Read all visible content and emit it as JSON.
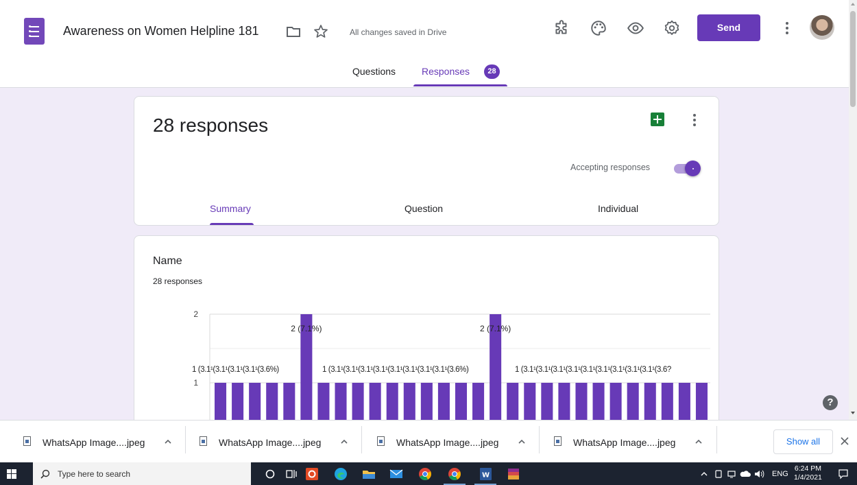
{
  "header": {
    "doc_title": "Awareness on Women Helpline 181",
    "save_status": "All changes saved in Drive",
    "send_label": "Send",
    "tabs": [
      {
        "label": "Questions"
      },
      {
        "label": "Responses",
        "badge": "28"
      }
    ]
  },
  "summary_card": {
    "response_count": "28 responses",
    "accepting_label": "Accepting responses",
    "accepting_on": true,
    "sub_tabs": [
      "Summary",
      "Question",
      "Individual"
    ]
  },
  "question_card": {
    "title": "Name",
    "responses": "28 responses"
  },
  "chart_data": {
    "type": "bar",
    "categories_count": 29,
    "values": [
      1,
      1,
      1,
      1,
      1,
      2,
      1,
      1,
      1,
      1,
      1,
      1,
      1,
      1,
      1,
      1,
      2,
      1,
      1,
      1,
      1,
      1,
      1,
      1,
      1,
      1,
      1,
      1,
      1
    ],
    "data_labels_single": "1 (3.6%)",
    "data_labels_double": "2 (7.1%)",
    "yticks": [
      "2",
      "1"
    ],
    "ylim": [
      0,
      2
    ],
    "bar_color": "#673ab7",
    "visible_label_text": {
      "left_group": "1 (3.1¹(3.1¹(3.1¹(3.1¹(3.6%)",
      "mid_group": "1 (3.1¹(3.1¹(3.1¹(3.1¹(3.1¹(3.1¹(3.1¹(3.1¹(3.6%)",
      "right_group": "1 (3.1¹(3.1¹(3.1¹(3.1¹(3.1¹(3.1¹(3.1¹(3.1¹(3.1¹(3.6?"
    }
  },
  "downloads": {
    "items": [
      {
        "name": "WhatsApp Image....jpeg"
      },
      {
        "name": "WhatsApp Image....jpeg"
      },
      {
        "name": "WhatsApp Image....jpeg"
      },
      {
        "name": "WhatsApp Image....jpeg"
      }
    ],
    "show_all": "Show all"
  },
  "taskbar": {
    "search_placeholder": "Type here to search",
    "language": "ENG",
    "time": "6:24 PM",
    "date": "1/4/2021"
  },
  "colors": {
    "accent": "#673ab7",
    "background": "#f0ebf8",
    "sheets": "#188038"
  }
}
